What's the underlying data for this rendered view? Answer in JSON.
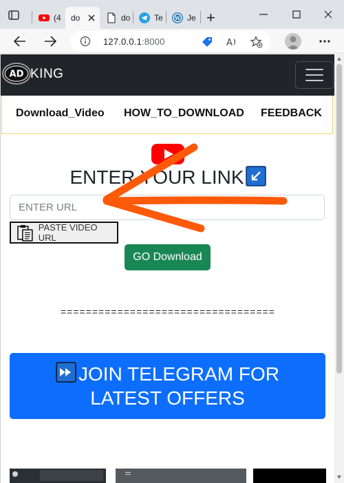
{
  "browser": {
    "tabs": [
      {
        "label": "(4",
        "icon": "youtube-icon"
      },
      {
        "label": "do",
        "icon": "document-icon",
        "active": true
      },
      {
        "label": "do",
        "icon": "document-icon"
      },
      {
        "label": "Te",
        "icon": "telegram-icon"
      },
      {
        "label": "Je",
        "icon": "wordpress-icon"
      }
    ],
    "new_tab": "+",
    "address": {
      "host": "127.0.0.1",
      "port": ":8000"
    }
  },
  "site": {
    "brand": "KING",
    "logo_text": "AD",
    "menu": [
      "Download_Video",
      "HOW_TO_DOWNLOAD",
      "FEEDBACK"
    ],
    "heading": "ENTER YOUR LINK",
    "url_input": {
      "placeholder": "ENTER URL",
      "value": ""
    },
    "paste_label": "PASTE VIDEO URL",
    "go_label": "GO Download",
    "divider": "==================================",
    "telegram_line1": "JOIN TELEGRAM FOR",
    "telegram_line2": "LATEST OFFERS"
  },
  "colors": {
    "nav_bg": "#212529",
    "go_green": "#198754",
    "telegram_blue": "#0d6efd",
    "annotation_orange": "#ff5a0a",
    "youtube_red": "#ff0000"
  }
}
